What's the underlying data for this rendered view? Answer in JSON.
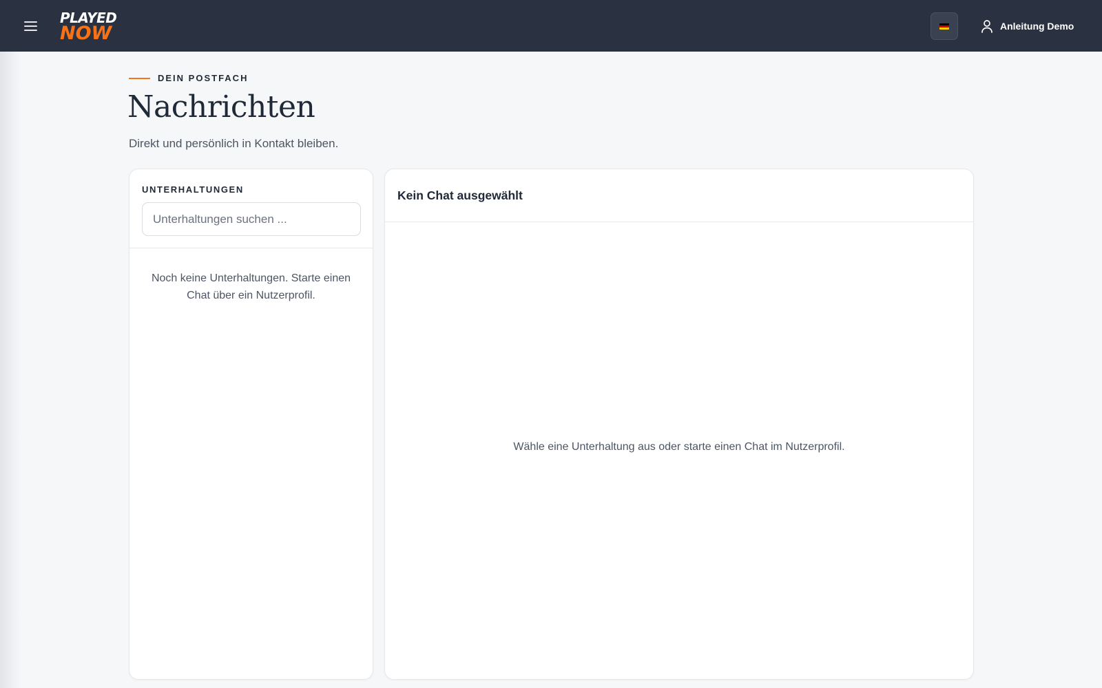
{
  "header": {
    "logo_top": "PLAYED",
    "logo_bottom": "NOW",
    "language_flag": "de-flag",
    "user_name": "Anleitung Demo"
  },
  "page": {
    "eyebrow": "DEIN POSTFACH",
    "title": "Nachrichten",
    "subtitle": "Direkt und persönlich in Kontakt bleiben."
  },
  "conversations": {
    "label": "UNTERHALTUNGEN",
    "search_placeholder": "Unterhaltungen suchen ...",
    "empty_text": "Noch keine Unterhaltungen. Starte einen Chat über ein Nutzerprofil."
  },
  "chat": {
    "title": "Kein Chat ausgewählt",
    "empty_text": "Wähle eine Unterhaltung aus oder starte einen Chat im Nutzerprofil."
  },
  "colors": {
    "topbar": "#2a3241",
    "accent": "#f97316",
    "background": "#f6f7f9",
    "flag": [
      "#000000",
      "#dd0000",
      "#ffce00"
    ]
  },
  "icons": {
    "menu": "hamburger-menu-icon",
    "user": "user-icon"
  }
}
